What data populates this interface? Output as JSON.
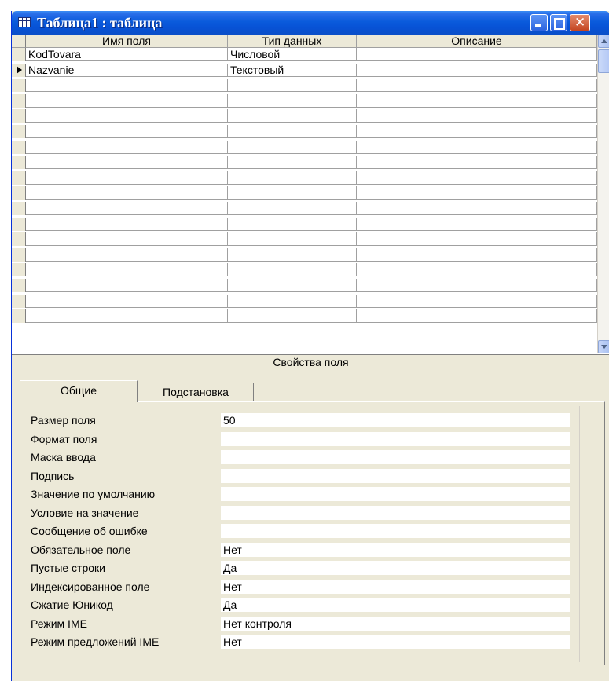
{
  "window": {
    "title": "Таблица1 : таблица"
  },
  "grid": {
    "headers": [
      "Имя поля",
      "Тип данных",
      "Описание"
    ],
    "rows": [
      {
        "name": "KodTovara",
        "type": "Числовой",
        "description": ""
      },
      {
        "name": "Nazvanie",
        "type": "Текстовый",
        "description": ""
      }
    ]
  },
  "properties": {
    "title": "Свойства поля",
    "tabs": [
      "Общие",
      "Подстановка"
    ],
    "items": [
      {
        "label": "Размер поля",
        "value": "50"
      },
      {
        "label": "Формат поля",
        "value": ""
      },
      {
        "label": "Маска ввода",
        "value": ""
      },
      {
        "label": "Подпись",
        "value": ""
      },
      {
        "label": "Значение по умолчанию",
        "value": ""
      },
      {
        "label": "Условие на значение",
        "value": ""
      },
      {
        "label": "Сообщение об ошибке",
        "value": ""
      },
      {
        "label": "Обязательное поле",
        "value": "Нет"
      },
      {
        "label": "Пустые строки",
        "value": "Да"
      },
      {
        "label": "Индексированное поле",
        "value": "Нет"
      },
      {
        "label": "Сжатие Юникод",
        "value": "Да"
      },
      {
        "label": "Режим IME",
        "value": "Нет контроля"
      },
      {
        "label": "Режим предложений IME",
        "value": "Нет"
      }
    ]
  },
  "colors": {
    "titlebar": "#0a5bdc",
    "panel": "#ece9d8",
    "close": "#c44520"
  },
  "icons": [
    "table-icon",
    "minimize-icon",
    "maximize-icon",
    "close-icon",
    "record-selector-icon",
    "scroll-up-icon",
    "scroll-down-icon"
  ]
}
